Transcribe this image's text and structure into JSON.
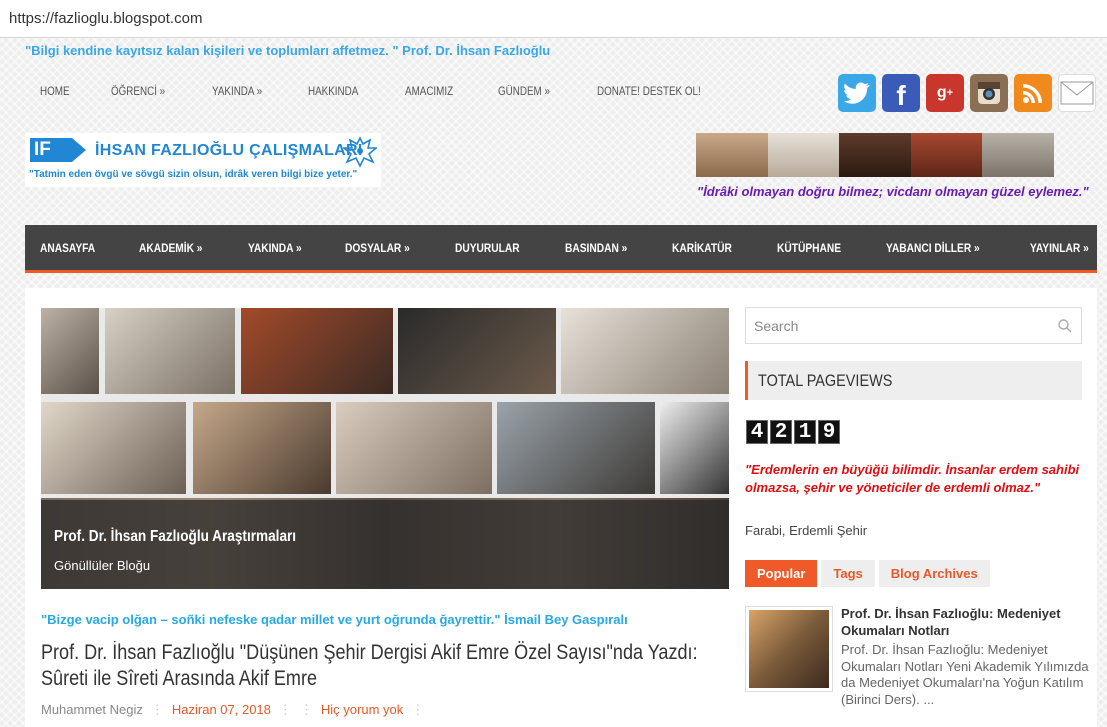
{
  "browser": {
    "url": "https://fazlioglu.blogspot.com"
  },
  "header": {
    "top_quote": "\"Bilgi kendine kayıtsız kalan kişileri ve toplumları affetmez. \" Prof. Dr. İhsan Fazlıoğlu",
    "top_nav": [
      "HOME",
      "ÖĞRENCİ »",
      "YAKINDA »",
      "HAKKINDA",
      "AMACIMIZ",
      "GÜNDEM »",
      "DONATE! DESTEK OL!"
    ],
    "social_icons": [
      "twitter-icon",
      "facebook-icon",
      "googleplus-icon",
      "instagram-icon",
      "rss-icon",
      "mail-icon"
    ],
    "logo": {
      "mark": "IF",
      "name": "İHSAN FAZLIOĞLU ÇALIŞMALARI",
      "motto": "\"Tatmin eden övgü ve sövgü sizin olsun, idrâk veren bilgi bize yeter.\""
    },
    "right_quote": "\"İdrâki olmayan doğru bilmez; vicdanı olmayan güzel eylemez.\""
  },
  "main_nav": [
    "ANASAYFA",
    "AKADEMİK »",
    "YAKINDA »",
    "DOSYALAR »",
    "DUYURULAR",
    "BASINDAN »",
    "KARİKATÜR",
    "KÜTÜPHANE",
    "YABANCI DİLLER »",
    "YAYINLAR »"
  ],
  "hero": {
    "title": "Prof. Dr. İhsan Fazlıoğlu Araştırmaları",
    "subtitle": "Gönüllüler Bloğu"
  },
  "post": {
    "quote": "\"Bizge vacip olğan – soñki nefeske qadar millet ve yurt oğrunda ğayrettir.\" İsmail Bey Gaspıralı",
    "title_line1": "Prof. Dr. İhsan Fazlıoğlu \"Düşünen Şehir Dergisi Akif Emre Özel Sayısı\"nda Yazdı:",
    "title_line2": "Sûreti ile Sîreti Arasında Akif Emre",
    "author": "Muhammet Negiz",
    "date": "Haziran 07, 2018",
    "comments": "Hiç yorum yok"
  },
  "sidebar": {
    "search_placeholder": "Search",
    "pageviews_title": "TOTAL PAGEVIEWS",
    "pageviews_digits": [
      "4",
      "2",
      "1",
      "9"
    ],
    "farabi_quote": "\"Erdemlerin en büyüğü bilimdir. İnsanlar erdem sahibi olmazsa, şehir ve yöneticiler de erdemli olmaz.\"",
    "farabi_source": "Farabi, Erdemli Şehir",
    "tabs": [
      "Popular",
      "Tags",
      "Blog Archives"
    ],
    "popular_post": {
      "title": "Prof. Dr. İhsan Fazlıoğlu: Medeniyet Okumaları Notları",
      "excerpt": "Prof. Dr. İhsan Fazlıoğlu: Medeniyet Okumaları Notları Yeni Akademik Yılımızda da Medeniyet Okumaları'na Yoğun Katılım (Birinci Ders). ..."
    }
  },
  "colors": {
    "accent": "#f05a28",
    "link_blue": "#27a9e1",
    "nav_bg": "#444444",
    "quote_red": "#e10d10",
    "quote_purple": "#6a1bb3"
  }
}
